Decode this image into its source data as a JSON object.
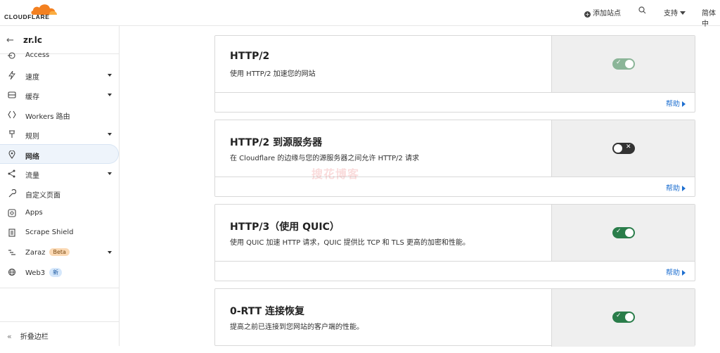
{
  "colors": {
    "brand_orange": "#f38020",
    "toggle_on": "#2a7d4a",
    "toggle_on_disabled": "#8bb598",
    "toggle_off": "#333333",
    "link": "#1e6fd0"
  },
  "header": {
    "logo_text": "CLOUDFLARE",
    "add_site": "添加站点",
    "support": "支持",
    "language": "简体中"
  },
  "sidebar": {
    "domain": "zr.lc",
    "items": [
      {
        "label": "Access",
        "icon": "access-icon",
        "has_dropdown": false
      },
      {
        "label": "速度",
        "icon": "lightning-icon",
        "has_dropdown": true
      },
      {
        "label": "缓存",
        "icon": "cache-icon",
        "has_dropdown": true
      },
      {
        "label": "Workers 路由",
        "icon": "workers-icon",
        "has_dropdown": false
      },
      {
        "label": "规则",
        "icon": "rules-icon",
        "has_dropdown": true
      },
      {
        "label": "网络",
        "icon": "network-icon",
        "has_dropdown": false,
        "active": true
      },
      {
        "label": "流量",
        "icon": "traffic-icon",
        "has_dropdown": true
      },
      {
        "label": "自定义页面",
        "icon": "wrench-icon",
        "has_dropdown": false
      },
      {
        "label": "Apps",
        "icon": "apps-icon",
        "has_dropdown": false
      },
      {
        "label": "Scrape Shield",
        "icon": "document-icon",
        "has_dropdown": false
      },
      {
        "label": "Zaraz",
        "icon": "zaraz-icon",
        "has_dropdown": true,
        "badge": "Beta"
      },
      {
        "label": "Web3",
        "icon": "web3-icon",
        "has_dropdown": false,
        "badge": "新"
      }
    ],
    "collapse_label": "折叠边栏"
  },
  "cards": [
    {
      "title": "HTTP/2",
      "description": "使用 HTTP/2 加速您的网站",
      "toggle_state": "on-disabled",
      "help": "帮助"
    },
    {
      "title": "HTTP/2 到源服务器",
      "description": "在 Cloudflare 的边缘与您的源服务器之间允许 HTTP/2 请求",
      "toggle_state": "off",
      "help": "帮助"
    },
    {
      "title": "HTTP/3（使用 QUIC）",
      "description": "使用 QUIC 加速 HTTP 请求，QUIC 提供比 TCP 和 TLS 更高的加密和性能。",
      "toggle_state": "on",
      "help": "帮助"
    },
    {
      "title": "0-RTT 连接恢复",
      "description": "提高之前已连接到您网站的客户端的性能。",
      "toggle_state": "on"
    }
  ],
  "watermark": "搜花博客"
}
